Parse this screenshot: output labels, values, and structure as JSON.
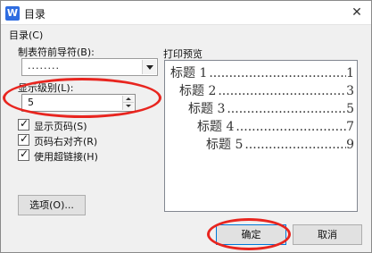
{
  "window": {
    "app_icon": "W",
    "title": "目录",
    "close_glyph": "✕"
  },
  "options": {
    "group_label": "目录(C)",
    "leader_label": "制表符前导符(B):",
    "leader_value": "........",
    "level_label": "显示级别(L):",
    "level_value": "5",
    "show_page_numbers": {
      "label": "显示页码(S)",
      "checked": true
    },
    "right_align": {
      "label": "页码右对齐(R)",
      "checked": true
    },
    "hyperlinks": {
      "label": "使用超链接(H)",
      "checked": true
    },
    "options_button": "选项(O)..."
  },
  "preview": {
    "label": "打印预览",
    "entries": [
      {
        "title": "标题 1",
        "page": "1"
      },
      {
        "title": "标题 2",
        "page": "3"
      },
      {
        "title": "标题 3",
        "page": "5"
      },
      {
        "title": "标题 4",
        "page": "7"
      },
      {
        "title": "标题 5",
        "page": "9"
      }
    ]
  },
  "footer": {
    "ok": "确定",
    "cancel": "取消"
  },
  "colors": {
    "annotation": "#e8251f",
    "accent": "#0078d7"
  },
  "icons": {
    "app": "wps-writer-icon",
    "close": "close-icon",
    "dropdown": "chevron-down-icon",
    "check": "checkmark-icon"
  }
}
